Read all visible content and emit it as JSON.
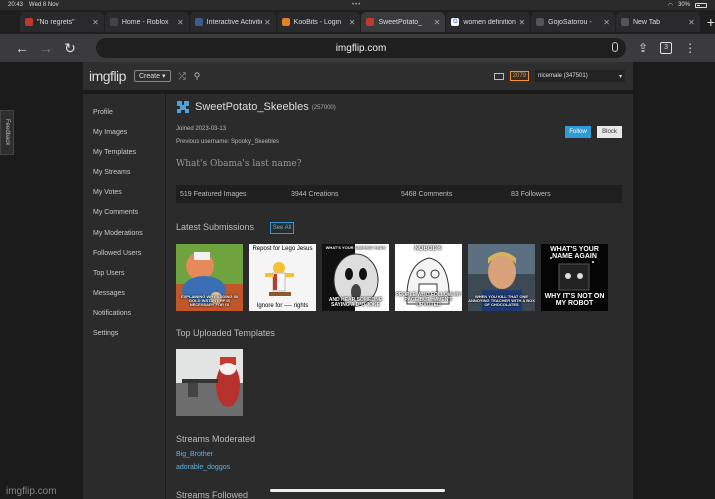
{
  "status_bar": {
    "time": "20:43",
    "date": "Wed 8 Nov",
    "battery": "30%"
  },
  "tabs": [
    {
      "title": "\"No regrets\"",
      "icon": "imgflip-favicon",
      "color": "#c0392b"
    },
    {
      "title": "Home - Roblox",
      "icon": "roblox-favicon",
      "color": "#444"
    },
    {
      "title": "Interactive Activities",
      "icon": "activity-favicon",
      "color": "#3b5d8a"
    },
    {
      "title": "KooBits - Login",
      "icon": "koobits-favicon",
      "color": "#e67e22"
    },
    {
      "title": "SweetPotato_",
      "icon": "imgflip-favicon",
      "color": "#c0392b",
      "active": true
    },
    {
      "title": "women definition",
      "icon": "google-favicon",
      "color": "#ffffff"
    },
    {
      "title": "GojoSatorou -",
      "icon": "page-favicon",
      "color": "#555"
    },
    {
      "title": "New Tab",
      "icon": "newtab-favicon",
      "color": "#555"
    }
  ],
  "address_bar": {
    "url": "imgflip.com",
    "tab_count": "3"
  },
  "header": {
    "logo": "imgflip",
    "create_label": "Create",
    "points": "2079",
    "user_label": "nicemale (347501)"
  },
  "feedback_label": "Feedback",
  "sidebar": {
    "items": [
      {
        "label": "Profile"
      },
      {
        "label": "My Images"
      },
      {
        "label": "My Templates"
      },
      {
        "label": "My Streams"
      },
      {
        "label": "My Votes"
      },
      {
        "label": "My Comments"
      },
      {
        "label": "My Moderations"
      },
      {
        "label": "Followed Users"
      },
      {
        "label": "Top Users"
      },
      {
        "label": "Messages"
      },
      {
        "label": "Notifications"
      },
      {
        "label": "Settings"
      }
    ]
  },
  "profile": {
    "username": "SweetPotato_Skeebles",
    "points": "(257000)",
    "joined": "Joined 2023-03-13",
    "previous_names": "Previous username: Spooky_Skeebles",
    "follow_label": "Follow",
    "block_label": "Block",
    "bio": "What's Obama's last name?"
  },
  "stats": {
    "featured": "519 Featured Images",
    "creations": "3944 Creations",
    "comments": "5468 Comments",
    "followers": "83 Followers"
  },
  "latest": {
    "title": "Latest Submissions",
    "see_all_label": "See All",
    "thumbnails": [
      {
        "caption_bottom": "EXPLAINING WHY ADDING 50 GOLD INSTANT HP IS NECESSARY FOR GI"
      },
      {
        "caption_top": "Repost for Lego Jesus",
        "caption_bottom": "Ignore for ---- rights"
      },
      {
        "caption_top": "WHAT'S YOUR DEEPEST FEAR",
        "caption_bottom": "AND HEAR SOMEONE SAYING A D*D JOKE"
      },
      {
        "caption_top": "NOBODY:",
        "caption_bottom": "PEOPLE WHO FOLLOW MY PAGE BUT HAVEN'T UPVOTED"
      },
      {
        "caption_bottom": "WHEN YOU KILL THAT ONE ANNOYING TEACHER WITH A BOX OF CHOCOLATES"
      },
      {
        "caption_top": "WHAT'S YOUR NAME AGAIN",
        "caption_bottom": "WHY IT'S NOT ON MY ROBOT"
      }
    ]
  },
  "templates": {
    "title": "Top Uploaded Templates"
  },
  "streams_moderated": {
    "title": "Streams Moderated",
    "items": [
      "Big_Brother",
      "adorable_doggos"
    ]
  },
  "streams_followed": {
    "title": "Streams Followed"
  },
  "watermark": "imgflip.com",
  "colors": {
    "accent": "#2f9bd6",
    "points": "#f6932e",
    "panel": "#2b2b2b"
  }
}
